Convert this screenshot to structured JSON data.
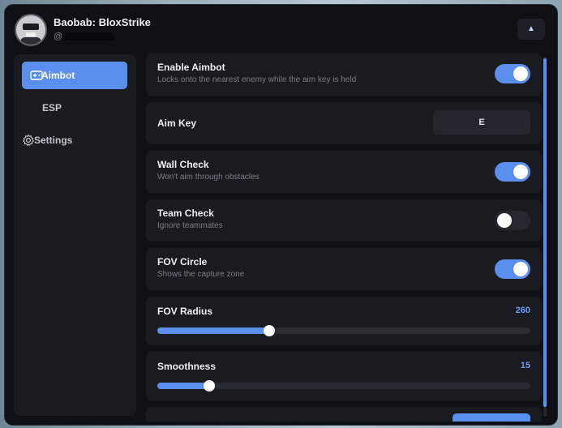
{
  "app": {
    "title": "Baobab: BloxStrike",
    "username_prefix": "@",
    "collapse_icon": "chevron-up-icon"
  },
  "sidebar": {
    "items": [
      {
        "label": "Aimbot",
        "icon": "gamepad-icon",
        "active": true
      },
      {
        "label": "ESP",
        "icon": "",
        "active": false
      },
      {
        "label": "Settings",
        "icon": "gear-icon",
        "active": false
      }
    ]
  },
  "aimbot": {
    "enable": {
      "name": "Enable Aimbot",
      "desc": "Locks onto the nearest enemy while the aim key is held",
      "on": true
    },
    "aim_key": {
      "name": "Aim Key",
      "value": "E"
    },
    "wall_check": {
      "name": "Wall Check",
      "desc": "Won't aim through obstacles",
      "on": true
    },
    "team_check": {
      "name": "Team Check",
      "desc": "Ignore teammates",
      "on": false
    },
    "fov_circle": {
      "name": "FOV Circle",
      "desc": "Shows the capture zone",
      "on": true
    },
    "fov_radius": {
      "name": "FOV Radius",
      "value": "260",
      "fraction": 0.3
    },
    "smoothness": {
      "name": "Smoothness",
      "value": "15",
      "fraction": 0.14
    }
  },
  "colors": {
    "accent": "#5a8ff0",
    "window_bg": "#0f1015",
    "card_bg": "#1a1b21"
  }
}
